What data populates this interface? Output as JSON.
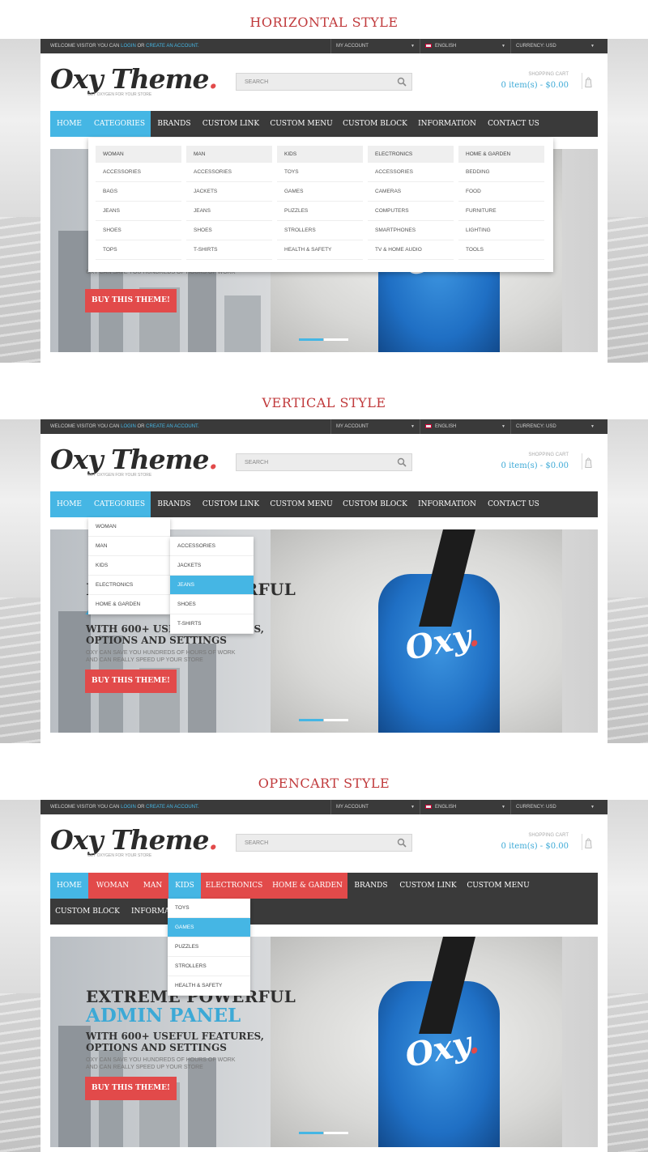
{
  "sections": [
    {
      "title": "HORIZONTAL STYLE"
    },
    {
      "title": "VERTICAL STYLE"
    },
    {
      "title": "OPENCART STYLE"
    }
  ],
  "topbar": {
    "welcome_prefix": "WELCOME VISITOR YOU CAN",
    "login": "LOGIN",
    "or": "OR",
    "create_account": "CREATE AN ACCOUNT.",
    "my_account": "MY ACCOUNT",
    "language": "ENGLISH",
    "currency": "CURRENCY: USD"
  },
  "logo": {
    "text": "Oxy Theme",
    "dot": ".",
    "tagline": "GET OXYGEN FOR YOUR STORE"
  },
  "search": {
    "placeholder": "SEARCH"
  },
  "cart": {
    "label": "SHOPPING CART",
    "value": "0 item(s) - $0.00"
  },
  "nav": {
    "home": "HOME",
    "categories": "CATEGORIES",
    "brands": "BRANDS",
    "custom_link": "CUSTOM LINK",
    "custom_menu": "CUSTOM MENU",
    "custom_block": "CUSTOM BLOCK",
    "information": "INFORMATION",
    "contact_us": "CONTACT US"
  },
  "mega_menu": [
    {
      "heading": "WOMAN",
      "items": [
        "ACCESSORIES",
        "BAGS",
        "JEANS",
        "SHOES",
        "TOPS"
      ]
    },
    {
      "heading": "MAN",
      "items": [
        "ACCESSORIES",
        "JACKETS",
        "JEANS",
        "SHOES",
        "T-SHIRTS"
      ]
    },
    {
      "heading": "KIDS",
      "items": [
        "TOYS",
        "GAMES",
        "PUZZLES",
        "STROLLERS",
        "HEALTH & SAFETY"
      ]
    },
    {
      "heading": "ELECTRONICS",
      "items": [
        "ACCESSORIES",
        "CAMERAS",
        "COMPUTERS",
        "SMARTPHONES",
        "TV & HOME AUDIO"
      ]
    },
    {
      "heading": "HOME & GARDEN",
      "items": [
        "BEDDING",
        "FOOD",
        "FURNITURE",
        "LIGHTING",
        "TOOLS"
      ]
    }
  ],
  "vertical_menu": {
    "level1": [
      "WOMAN",
      "MAN",
      "KIDS",
      "ELECTRONICS",
      "HOME & GARDEN"
    ],
    "level2": [
      "ACCESSORIES",
      "JACKETS",
      "JEANS",
      "SHOES",
      "T-SHIRTS"
    ],
    "active": "JEANS"
  },
  "opencart_menu": {
    "row1": [
      "HOME",
      "WOMAN",
      "MAN",
      "KIDS",
      "ELECTRONICS",
      "HOME & GARDEN",
      "BRANDS",
      "CUSTOM LINK",
      "CUSTOM MENU"
    ],
    "row2": [
      "CUSTOM BLOCK",
      "INFORMA"
    ],
    "kids_dropdown": [
      "TOYS",
      "GAMES",
      "PUZZLES",
      "STROLLERS",
      "HEALTH & SAFETY"
    ],
    "active": "GAMES"
  },
  "hero": {
    "line1": "EXTREME POWERFUL",
    "line2": "ADMIN PANEL",
    "line3a": "WITH 600+ USEFUL FEATURES,",
    "line3b": "OPTIONS AND SETTINGS",
    "p1": "OXY CAN SAVE YOU HUNDREDS OF HOURS OF WORK",
    "p2": "AND CAN REALLY SPEED UP YOUR STORE",
    "button": "BUY THIS THEME!",
    "brand": "Oxy",
    "brand_dot": "."
  },
  "colors": {
    "accent_blue": "#45b6e4",
    "accent_red": "#e24a4a",
    "dark_bar": "#3a3a3a",
    "title_red": "#c0393b"
  }
}
